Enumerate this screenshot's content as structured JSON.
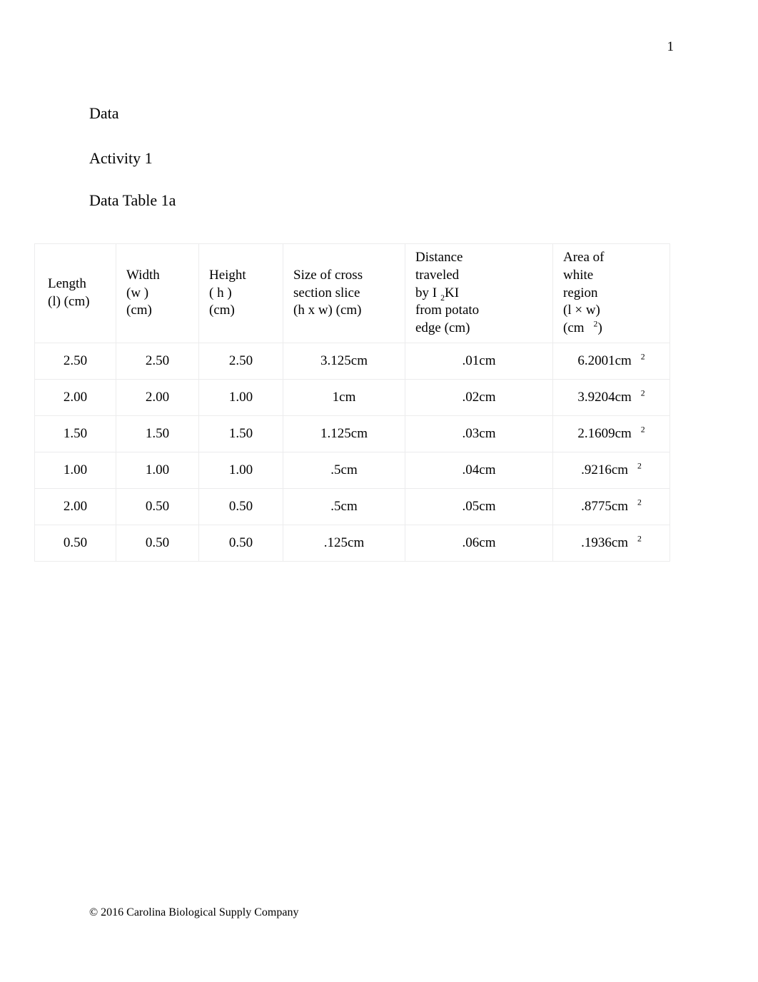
{
  "page": {
    "number": "1",
    "footer": "© 2016 Carolina Biological Supply Company"
  },
  "headings": {
    "data": "Data",
    "activity": "Activity 1",
    "table_title": "Data Table 1a"
  },
  "table": {
    "columns": [
      {
        "key": "length",
        "lines": [
          "Length",
          "(l) (cm)"
        ]
      },
      {
        "key": "width",
        "lines": [
          "Width",
          "(w )",
          "(cm)"
        ]
      },
      {
        "key": "height",
        "lines": [
          "Height",
          "( h )",
          "(cm)"
        ]
      },
      {
        "key": "cross_section",
        "lines": [
          "Size of cross",
          "section slice",
          "(h x w) (cm)"
        ]
      },
      {
        "key": "distance",
        "lines": [
          "Distance",
          "traveled",
          "by I ",
          "2",
          "KI",
          "from potato",
          "edge (cm)"
        ],
        "line1": "Distance",
        "line2": "traveled",
        "line3_pre": "by I",
        "line3_sub": "2",
        "line3_post": "KI",
        "line4": "from potato",
        "line5": "edge (cm)"
      },
      {
        "key": "area",
        "line1": "Area of",
        "line2": "white",
        "line3": "region",
        "line4": "(l × w)",
        "line5_pre": "(cm",
        "line5_sup": "2",
        "line5_post": ")"
      }
    ],
    "rows": [
      {
        "length": "2.50",
        "width": "2.50",
        "height": "2.50",
        "cross_section": "3.125cm",
        "distance": ".01cm",
        "area_value": "6.2001cm",
        "area_sup": "2"
      },
      {
        "length": "2.00",
        "width": "2.00",
        "height": "1.00",
        "cross_section": "1cm",
        "distance": ".02cm",
        "area_value": "3.9204cm",
        "area_sup": "2"
      },
      {
        "length": "1.50",
        "width": "1.50",
        "height": "1.50",
        "cross_section": "1.125cm",
        "distance": ".03cm",
        "area_value": "2.1609cm",
        "area_sup": "2"
      },
      {
        "length": "1.00",
        "width": "1.00",
        "height": "1.00",
        "cross_section": ".5cm",
        "distance": ".04cm",
        "area_value": ".9216cm",
        "area_sup": "2"
      },
      {
        "length": "2.00",
        "width": "0.50",
        "height": "0.50",
        "cross_section": ".5cm",
        "distance": ".05cm",
        "area_value": ".8775cm",
        "area_sup": "2"
      },
      {
        "length": "0.50",
        "width": "0.50",
        "height": "0.50",
        "cross_section": ".125cm",
        "distance": ".06cm",
        "area_value": ".1936cm",
        "area_sup": "2"
      }
    ]
  },
  "colors": {
    "answer_text": "#3d6fa8",
    "body_text": "#000000",
    "table_border": "#ececed"
  }
}
